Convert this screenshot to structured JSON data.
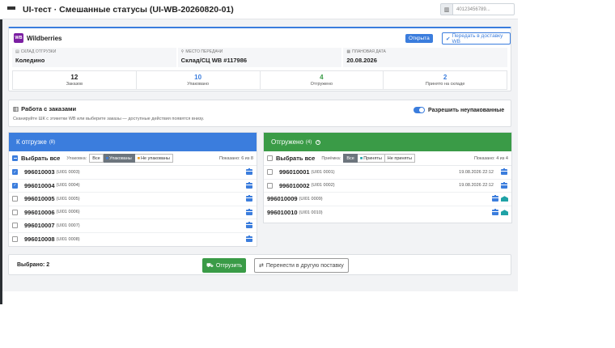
{
  "header": {
    "title": "UI-тест · Смешанные статусы (UI-WB-20260820-01)",
    "search_placeholder": "40123456789...",
    "search_icon": "barcode-icon"
  },
  "supply": {
    "logo_text": "WB",
    "marketplace": "Wildberries",
    "status": "Открыта",
    "transfer_button": "Передать в доставку WB",
    "warehouse_label": "СКЛАД ОТГРУЗКИ",
    "warehouse_value": "Коледино",
    "place_label": "МЕСТО ПЕРЕДАЧИ",
    "place_value": "Склад/СЦ WB #117986",
    "date_label": "ПЛАНОВАЯ ДАТА",
    "date_value": "20.08.2026",
    "stats": [
      {
        "value": "12",
        "label": "Заказов",
        "color": "#222222"
      },
      {
        "value": "10",
        "label": "Упаковано",
        "color": "#3b7ddd"
      },
      {
        "value": "4",
        "label": "Отгружено",
        "color": "#3a9b47"
      },
      {
        "value": "2",
        "label": "Принято на складе",
        "color": "#3b7ddd"
      }
    ]
  },
  "work": {
    "title": "Работа с заказами",
    "hint": "Сканируйте ШК с этикетки WB или выберите заказы — доступные действия появятся внизу.",
    "toggle_label": "Разрешить неупакованные"
  },
  "left_panel": {
    "title": "К отгрузке",
    "count": "(8)",
    "select_all": "Выбрать все",
    "filter_label": "Упаковка:",
    "filters": [
      "Все",
      "Упакованы",
      "Не упакованы"
    ],
    "shown": "Показано: 6 из 8",
    "rows": [
      {
        "code": "996010003",
        "sub": "(UI01 0003)",
        "checked": true
      },
      {
        "code": "996010004",
        "sub": "(UI01 0004)",
        "checked": true
      },
      {
        "code": "996010005",
        "sub": "(UI01 0005)",
        "checked": false
      },
      {
        "code": "996010006",
        "sub": "(UI01 0006)",
        "checked": false
      },
      {
        "code": "996010007",
        "sub": "(UI01 0007)",
        "checked": false
      },
      {
        "code": "996010008",
        "sub": "(UI01 0008)",
        "checked": false
      }
    ]
  },
  "right_panel": {
    "title": "Отгружено",
    "count": "(4)",
    "select_all": "Выбрать все",
    "filter_label": "Приёмка:",
    "filters": [
      "Все",
      "Приняты",
      "Не приняты"
    ],
    "shown": "Показано: 4 из 4",
    "rows": [
      {
        "code": "996010001",
        "sub": "(UI01 0001)",
        "date": "19.08.2026 22:12"
      },
      {
        "code": "996010002",
        "sub": "(UI01 0002)",
        "date": "19.08.2026 22:12"
      },
      {
        "code": "996010009",
        "sub": "(UI01 0009)",
        "date": ""
      },
      {
        "code": "996010010",
        "sub": "(UI01 0010)",
        "date": ""
      }
    ]
  },
  "bottom": {
    "selected": "Выбрано: 2",
    "ship_button": "Отгрузить",
    "move_button": "Перенести в другую поставку"
  }
}
